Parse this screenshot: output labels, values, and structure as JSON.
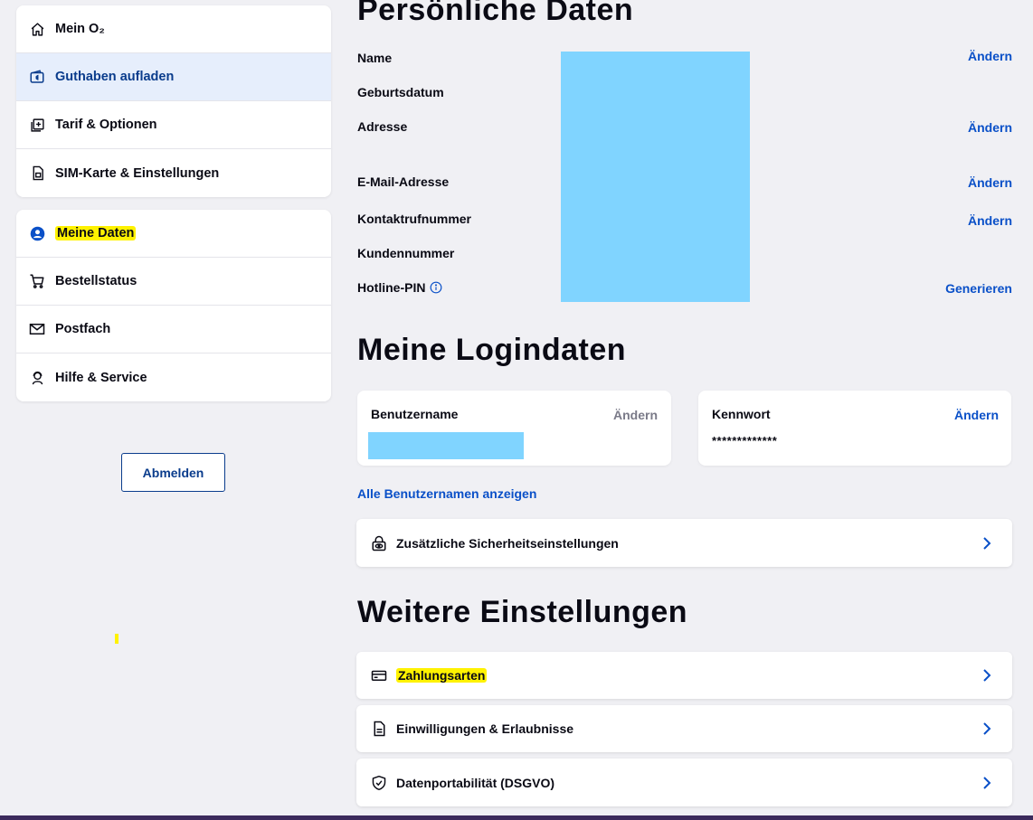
{
  "sidebar": {
    "group1": [
      {
        "label": "Mein O₂",
        "icon": "home-icon"
      },
      {
        "label": "Guthaben aufladen",
        "icon": "wallet-euro-icon",
        "active": true
      },
      {
        "label": "Tarif & Optionen",
        "icon": "add-square-icon"
      },
      {
        "label": "SIM-Karte & Einstellungen",
        "icon": "sim-card-icon"
      }
    ],
    "group2": [
      {
        "label": "Meine Daten",
        "icon": "user-circle-icon"
      },
      {
        "label": "Bestellstatus",
        "icon": "cart-icon"
      },
      {
        "label": "Postfach",
        "icon": "mail-icon"
      },
      {
        "label": "Hilfe & Service",
        "icon": "support-agent-icon"
      }
    ],
    "logout_label": "Abmelden"
  },
  "personal": {
    "title": "Persönliche Daten",
    "fields": [
      {
        "label": "Name",
        "action": "Ändern"
      },
      {
        "label": "Geburtsdatum",
        "action": ""
      },
      {
        "label": "Adresse",
        "action": "Ändern"
      },
      {
        "label": "E-Mail-Adresse",
        "action": "Ändern"
      },
      {
        "label": "Kontaktrufnummer",
        "action": "Ändern"
      },
      {
        "label": "Kundennummer",
        "action": ""
      },
      {
        "label": "Hotline-PIN",
        "action": "Generieren"
      }
    ]
  },
  "login": {
    "title": "Meine Logindaten",
    "username_label": "Benutzername",
    "username_action": "Ändern",
    "password_label": "Kennwort",
    "password_action": "Ändern",
    "password_value": "*************",
    "all_usernames_link": "Alle Benutzernamen anzeigen",
    "security_label": "Zusätzliche Sicherheitseinstellungen"
  },
  "settings": {
    "title": "Weitere Einstellungen",
    "items": [
      {
        "label": "Zahlungsarten",
        "icon": "credit-card-icon"
      },
      {
        "label": "Einwilligungen & Erlaubnisse",
        "icon": "document-icon"
      },
      {
        "label": "Datenportabilität (DSGVO)",
        "icon": "shield-check-icon"
      }
    ]
  },
  "colors": {
    "accent": "#0a50c8",
    "highlight": "#fff200",
    "redaction": "#80d4ff",
    "background": "#f0f0f4"
  }
}
